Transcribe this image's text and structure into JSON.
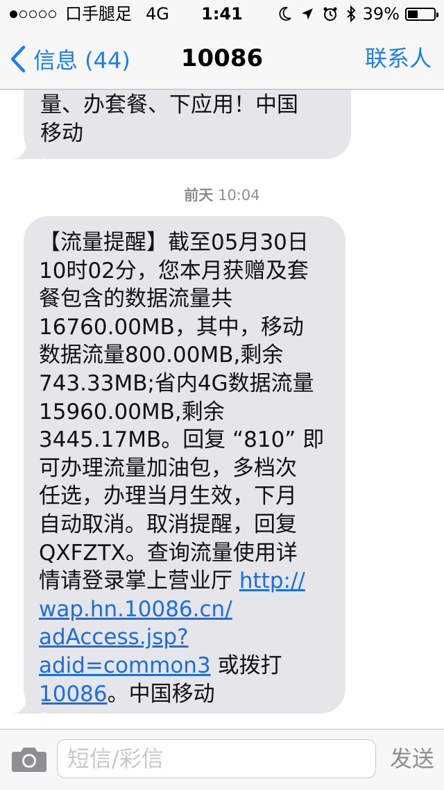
{
  "status_bar": {
    "carrier": "口手腿足",
    "network": "4G",
    "time": "1:41",
    "battery_percent_label": "39%",
    "battery_level": 0.39,
    "icons": [
      "moon-icon",
      "location-arrow-icon",
      "alarm-clock-icon",
      "bluetooth-icon"
    ]
  },
  "nav": {
    "back_label": "信息 (44)",
    "title": "10086",
    "right_label": "联系人"
  },
  "conversation": {
    "previous_message": {
      "lines": [
        "量、办套餐、下应用！中国",
        "移动"
      ]
    },
    "timestamp": {
      "day": "前天",
      "time": "10:04"
    },
    "message": {
      "lines": [
        "【流量提醒】截至05月30日",
        "10时02分，您本月获赠及套",
        "餐包含的数据流量共",
        "16760.00MB，其中，移动",
        "数据流量800.00MB,剩余",
        "743.33MB;省内4G数据流量",
        "15960.00MB,剩余",
        "3445.17MB。回复 “810” 即",
        "可办理流量加油包，多档次",
        "任选，办理当月生效，下月",
        "自动取消。取消提醒，回复",
        "QXFZTX。查询流量使用详"
      ],
      "line13_text": "情请登录掌上营业厅 ",
      "link_parts": [
        "http://",
        "wap.hn.10086.cn/",
        "adAccess.jsp?",
        "adid=common3"
      ],
      "after_link": " 或拨打",
      "phone_link": "10086",
      "closing": "。中国移动"
    }
  },
  "input_bar": {
    "placeholder": "短信/彩信",
    "value": "",
    "send_label": "发送"
  },
  "colors": {
    "accent": "#1a7ef5",
    "bubble": "#e5e5ea",
    "link": "#1a6fe0",
    "timestamp": "#8e8e93"
  }
}
